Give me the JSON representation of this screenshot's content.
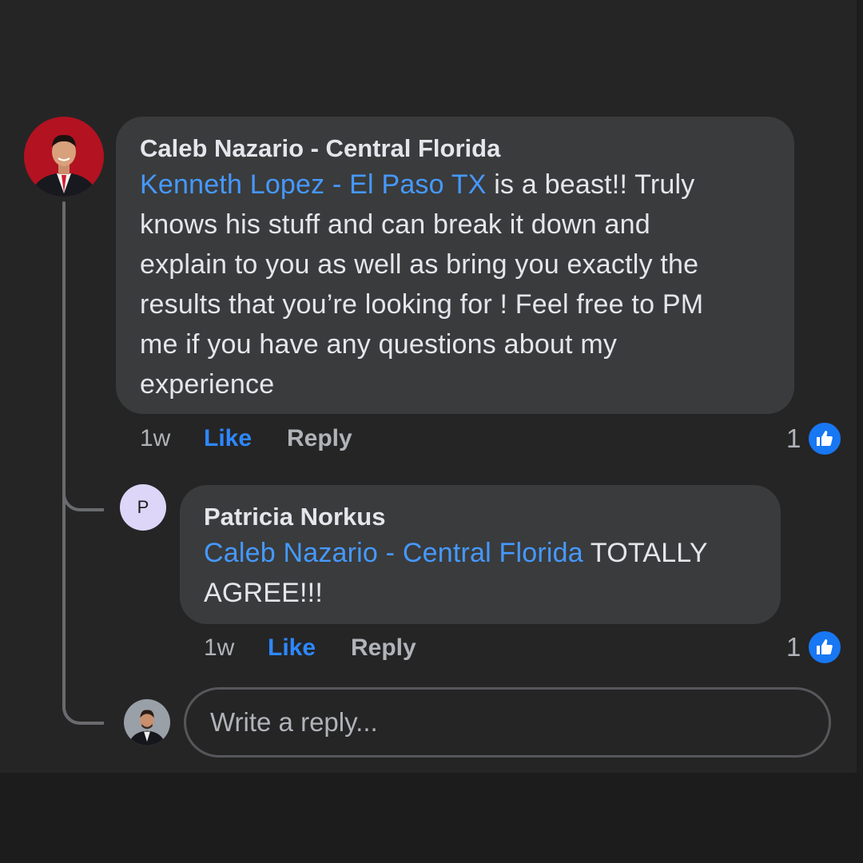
{
  "comment": {
    "author": "Caleb Nazario - Central Florida",
    "mention": "Kenneth Lopez - El Paso TX",
    "line1_rest": " is a beast!! Truly",
    "line2": "knows his stuff and can break it down and",
    "line3": "explain to you as well as bring you exactly the",
    "line4": "results that you’re looking for ! Feel free to PM",
    "line5": "me if you have any questions about my",
    "line6": "experience",
    "time": "1w",
    "like_label": "Like",
    "reply_label": "Reply",
    "reaction_count": "1"
  },
  "reply": {
    "author": "Patricia Norkus",
    "avatar_initial": "P",
    "mention": "Caleb Nazario - Central Florida",
    "line1_rest": " TOTALLY",
    "line2": "AGREE!!!",
    "time": "1w",
    "like_label": "Like",
    "reply_label": "Reply",
    "reaction_count": "1"
  },
  "composer": {
    "placeholder": "Write a reply..."
  },
  "colors": {
    "accent": "#2d88ff",
    "mention": "#4599ff",
    "bubble": "#3a3b3c",
    "background": "#252526"
  },
  "icons": {
    "reaction": "thumbs-up-icon"
  }
}
